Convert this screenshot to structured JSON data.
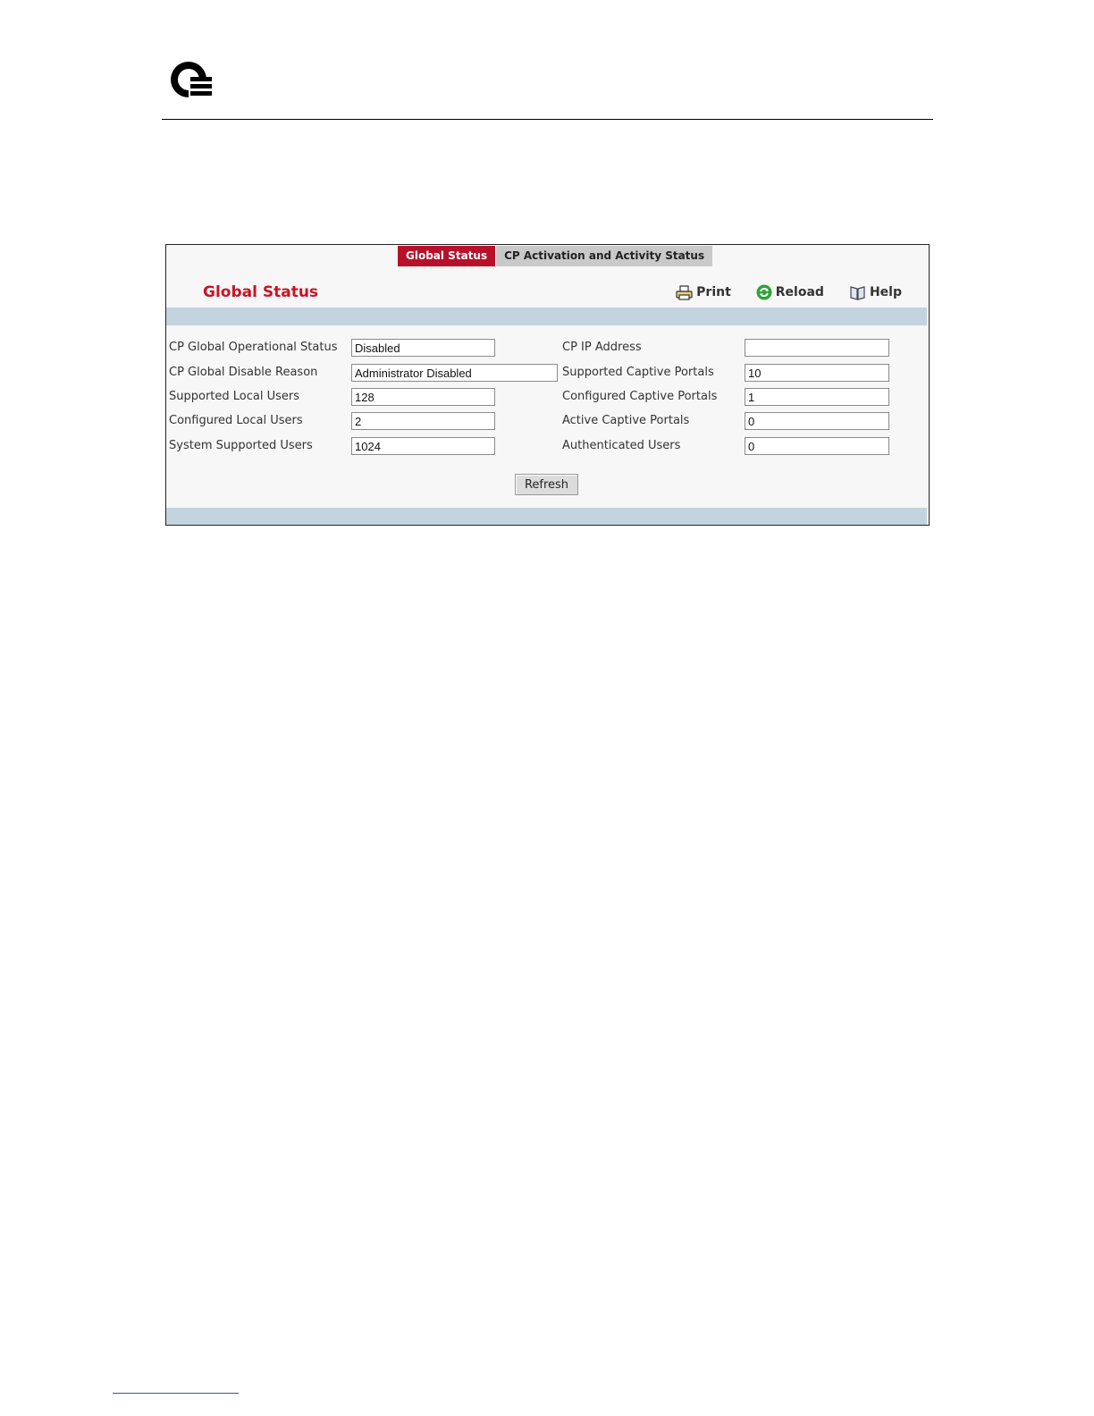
{
  "icons": {
    "logo": "q-logo",
    "print": "printer-icon",
    "reload": "reload-icon",
    "help": "book-icon"
  },
  "colors": {
    "accent": "#b8102b",
    "title": "#c81426",
    "band": "#c3d4df",
    "tab_inactive": "#c9c9c9"
  },
  "tabs": [
    {
      "label": "Global Status",
      "active": true
    },
    {
      "label": "CP Activation and Activity Status",
      "active": false
    }
  ],
  "page": {
    "title": "Global Status"
  },
  "toolbar": {
    "print": "Print",
    "reload": "Reload",
    "help": "Help"
  },
  "fields_left": [
    {
      "label": "CP Global Operational Status",
      "value": "Disabled"
    },
    {
      "label": "CP Global Disable Reason",
      "value": "Administrator Disabled"
    },
    {
      "label": "Supported Local Users",
      "value": "128"
    },
    {
      "label": "Configured Local Users",
      "value": "2"
    },
    {
      "label": "System Supported Users",
      "value": "1024"
    }
  ],
  "fields_right": [
    {
      "label": "CP IP Address",
      "value": ""
    },
    {
      "label": "Supported Captive Portals",
      "value": "10"
    },
    {
      "label": "Configured Captive Portals",
      "value": "1"
    },
    {
      "label": "Active Captive Portals",
      "value": "0"
    },
    {
      "label": "Authenticated Users",
      "value": "0"
    }
  ],
  "actions": {
    "refresh": "Refresh"
  }
}
